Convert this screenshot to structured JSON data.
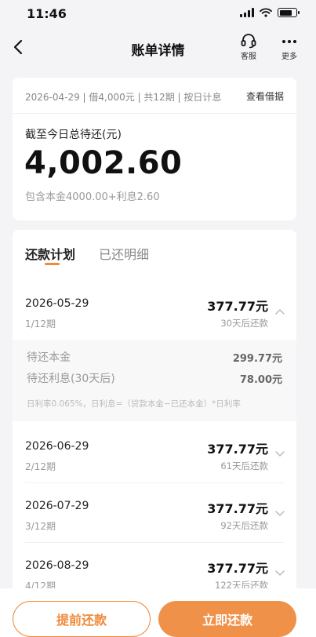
{
  "status_bar": {
    "time": "11:46"
  },
  "nav": {
    "title": "账单详情",
    "service_label": "客服",
    "more_label": "更多"
  },
  "loan": {
    "meta": "2026-04-29 | 借4,000元 | 共12期 | 按日计息",
    "view_loan": "查看借据",
    "due_label": "截至今日总待还(元)",
    "due_amount": "4,002.60",
    "breakdown": "包含本金4000.00+利息2.60"
  },
  "tabs": {
    "plan": "还款计划",
    "history": "已还明细"
  },
  "schedule": [
    {
      "date": "2026-05-29",
      "term": "1/12期",
      "amount": "377.77元",
      "countdown": "30天后还款",
      "expanded": true
    },
    {
      "date": "2026-06-29",
      "term": "2/12期",
      "amount": "377.77元",
      "countdown": "61天后还款",
      "expanded": false
    },
    {
      "date": "2026-07-29",
      "term": "3/12期",
      "amount": "377.77元",
      "countdown": "92天后还款",
      "expanded": false
    },
    {
      "date": "2026-08-29",
      "term": "4/12期",
      "amount": "377.77元",
      "countdown": "122天后还款",
      "expanded": false
    }
  ],
  "detail": {
    "principal_label": "待还本金",
    "principal_value": "299.77元",
    "interest_label": "待还利息(30天后)",
    "interest_value": "78.00元",
    "note": "日利率0.065%，日利息=（贷款本金−已还本金）*日利率"
  },
  "actions": {
    "prepay": "提前还款",
    "repay": "立即还款"
  },
  "colors": {
    "accent": "#f08a3a",
    "accent_fill": "#f0914a",
    "background": "#f4f4f6"
  }
}
